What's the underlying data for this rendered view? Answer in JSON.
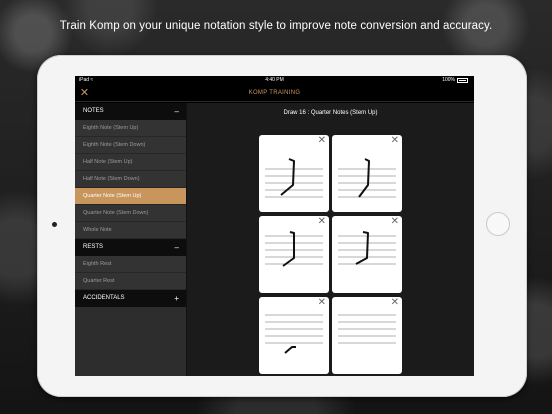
{
  "headline": "Train Komp on your unique notation style to improve note conversion and accuracy.",
  "status_bar": {
    "carrier": "iPad",
    "wifi_icon": "wifi-icon",
    "time": "4:40 PM",
    "battery": "100%"
  },
  "nav": {
    "close_icon": "close-icon",
    "title": "KOMP TRAINING"
  },
  "sidebar": {
    "notes": {
      "header": "NOTES",
      "toggle": "–",
      "items": [
        {
          "label": "Eighth Note (Stem Up)",
          "active": false
        },
        {
          "label": "Eighth Note (Stem Down)",
          "active": false
        },
        {
          "label": "Half Note (Stem Up)",
          "active": false
        },
        {
          "label": "Half Note (Stem Down)",
          "active": false
        },
        {
          "label": "Quarter Note (Stem Up)",
          "active": true
        },
        {
          "label": "Quarter Note (Stem Down)",
          "active": false
        },
        {
          "label": "Whole Note",
          "active": false
        }
      ]
    },
    "rests": {
      "header": "RESTS",
      "toggle": "–",
      "items": [
        {
          "label": "Eighth Rest",
          "active": false
        },
        {
          "label": "Quarter Rest",
          "active": false
        }
      ]
    },
    "accidentals": {
      "header": "ACCIDENTALS",
      "toggle": "+"
    }
  },
  "main": {
    "draw_title": "Draw 16 : Quarter Notes (Stem Up)",
    "card_close_glyph": "✕"
  },
  "colors": {
    "accent": "#c8955c",
    "sidebar_bg": "#333333",
    "section_bg": "#0d0d0d",
    "main_bg": "#1b1b1b"
  }
}
